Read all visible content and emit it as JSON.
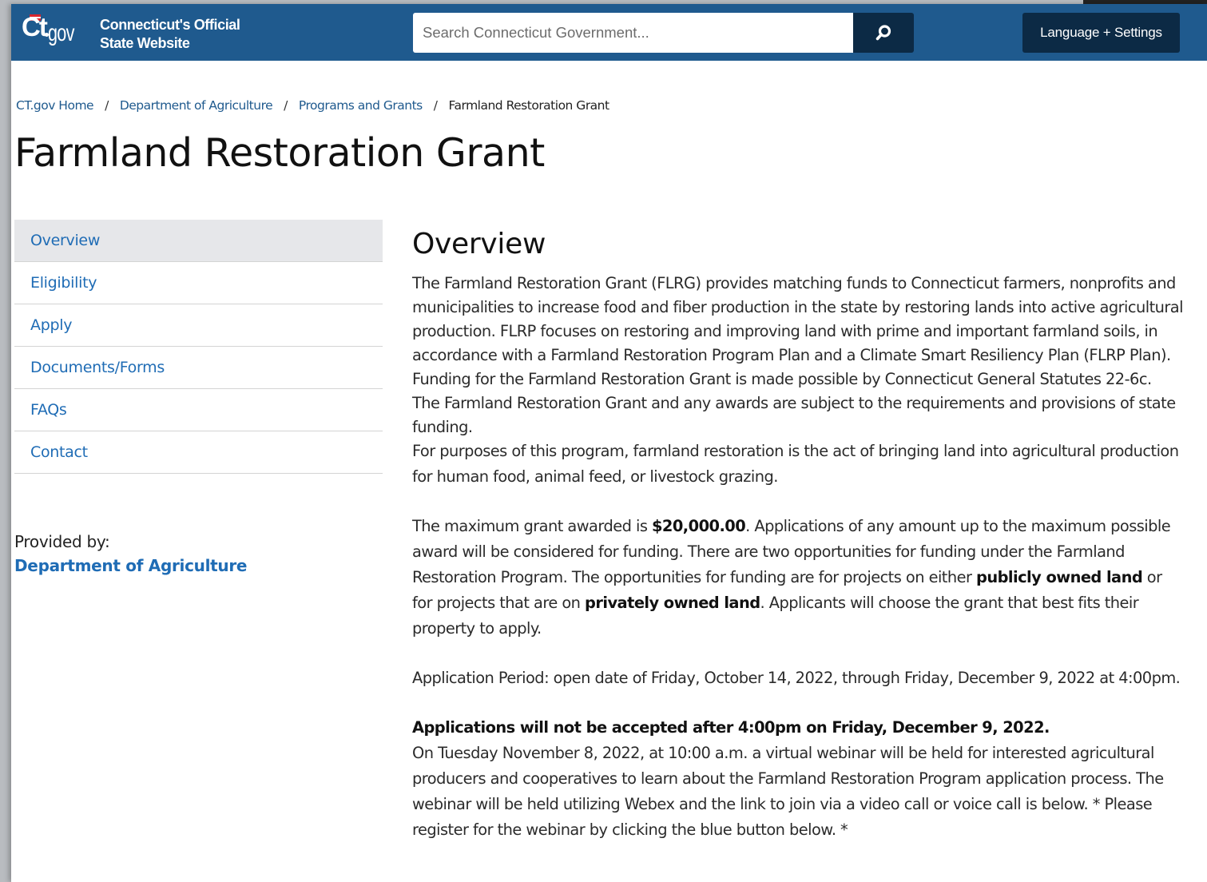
{
  "header": {
    "logo_ct": "Ct",
    "logo_gov": "gov",
    "tagline_line1": "Connecticut's Official",
    "tagline_line2": "State Website",
    "search_placeholder": "Search Connecticut Government...",
    "language_label": "Language + Settings"
  },
  "breadcrumb": {
    "items": [
      "CT.gov Home",
      "Department of Agriculture",
      "Programs and Grants"
    ],
    "current": "Farmland Restoration Grant",
    "separator": "/"
  },
  "page_title": "Farmland Restoration Grant",
  "sidebar": {
    "items": [
      {
        "label": "Overview",
        "active": true
      },
      {
        "label": "Eligibility"
      },
      {
        "label": "Apply"
      },
      {
        "label": "Documents/Forms"
      },
      {
        "label": "FAQs"
      },
      {
        "label": "Contact"
      }
    ],
    "provided_by_label": "Provided by:",
    "provided_by_link": "Department of Agriculture"
  },
  "main": {
    "heading": "Overview",
    "p1": "The Farmland Restoration Grant (FLRG) provides matching funds to Connecticut farmers, nonprofits and municipalities to increase food and fiber production in the state by restoring lands into active agricultural production. FLRP focuses on restoring and improving land with prime and important farmland soils, in accordance with a Farmland Restoration Program Plan and a Climate Smart Resiliency Plan (FLRP Plan).  Funding for the Farmland Restoration Grant is made possible by Connecticut General Statutes 22-6c.  The Farmland Restoration Grant and any awards are subject to the requirements and provisions of state funding.",
    "p2": "For purposes of this program, farmland restoration is the act of bringing land into agricultural production for human food, animal feed, or livestock grazing.",
    "p3_a": "The maximum grant awarded is ",
    "p3_amount": "$20,000.00",
    "p3_b": ".  Applications of any amount up to the maximum possible award will be considered for funding.  There are two opportunities for funding under the Farmland Restoration Program.  The opportunities for funding are for projects on either ",
    "p3_public": "publicly owned land",
    "p3_c": " or for projects that are on ",
    "p3_private": "privately owned land",
    "p3_d": ".  Applicants will choose the grant that best fits their property to apply.",
    "p4": "Application Period: open date of Friday, October 14, 2022, through Friday, December 9, 2022 at 4:00pm.",
    "p5": "Applications will not be accepted after 4:00pm on Friday, December 9, 2022.",
    "p6": "On Tuesday November 8, 2022, at 10:00 a.m. a virtual webinar will be held for interested agricultural producers and cooperatives to learn about the Farmland Restoration Program application process. The webinar will be held utilizing Webex and the link to join via a video call or voice call is below. * Please register for the webinar by clicking the blue button below. *"
  },
  "colors": {
    "header_bg": "#1f5a8e",
    "button_dark": "#0c2a45",
    "link": "#1f6cb5",
    "active_nav_bg": "#e6e7ea"
  },
  "icons": {
    "search": "search-icon",
    "logo_flag": "flag-icon"
  }
}
